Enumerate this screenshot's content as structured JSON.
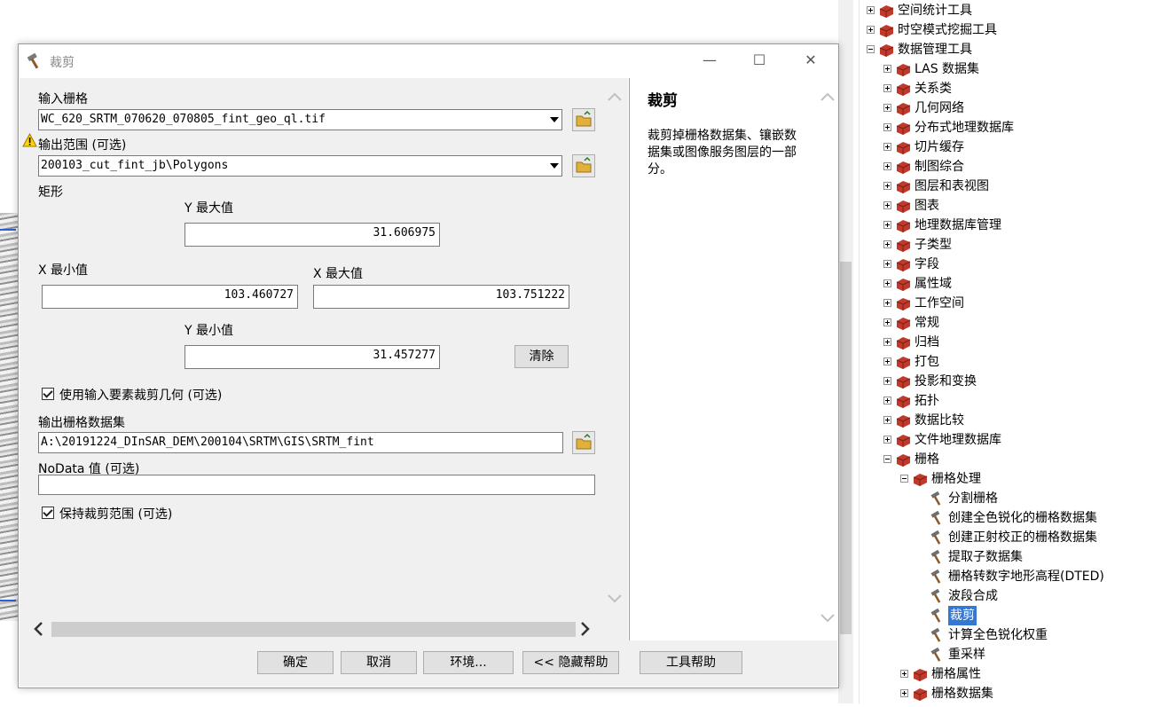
{
  "dialog": {
    "title": "裁剪",
    "input_raster_label": "输入栅格",
    "input_raster_value": "WC_620_SRTM_070620_070805_fint_geo_ql.tif",
    "output_extent_label": "输出范围 (可选)",
    "output_extent_value": "200103_cut_fint_jb\\Polygons",
    "rectangle_label": "矩形",
    "y_max_label": "Y 最大值",
    "y_max_value": "31.606975",
    "x_min_label": "X 最小值",
    "x_min_value": "103.460727",
    "x_max_label": "X 最大值",
    "x_max_value": "103.751222",
    "y_min_label": "Y 最小值",
    "y_min_value": "31.457277",
    "clear_button": "清除",
    "use_geometry_label": "使用输入要素裁剪几何 (可选)",
    "use_geometry_checked": true,
    "output_raster_label": "输出栅格数据集",
    "output_raster_value": "A:\\20191224_DInSAR_DEM\\200104\\SRTM\\GIS\\SRTM_fint",
    "nodata_label": "NoData 值 (可选)",
    "nodata_value": "",
    "maintain_extent_label": "保持裁剪范围 (可选)",
    "maintain_extent_checked": true,
    "help_title": "裁剪",
    "help_text": "裁剪掉栅格数据集、镶嵌数据集或图像服务图层的一部分。",
    "buttons": {
      "ok": "确定",
      "cancel": "取消",
      "env": "环境...",
      "hide_help": "<< 隐藏帮助",
      "tool_help": "工具帮助"
    }
  },
  "tree": {
    "top": [
      {
        "label": "空间统计工具",
        "state": "plus"
      },
      {
        "label": "时空模式挖掘工具",
        "state": "plus"
      },
      {
        "label": "数据管理工具",
        "state": "minus"
      }
    ],
    "data_mgmt_children": [
      "LAS 数据集",
      "关系类",
      "几何网络",
      "分布式地理数据库",
      "切片缓存",
      "制图综合",
      "图层和表视图",
      "图表",
      "地理数据库管理",
      "子类型",
      "字段",
      "属性域",
      "工作空间",
      "常规",
      "归档",
      "打包",
      "投影和变换",
      "拓扑",
      "数据比较",
      "文件地理数据库"
    ],
    "raster_label": "栅格",
    "raster_processing_label": "栅格处理",
    "raster_processing_tools": [
      "分割栅格",
      "创建全色锐化的栅格数据集",
      "创建正射校正的栅格数据集",
      "提取子数据集",
      "栅格转数字地形高程(DTED)",
      "波段合成",
      "裁剪",
      "计算全色锐化权重",
      "重采样"
    ],
    "selected_tool": "裁剪",
    "raster_siblings": [
      "栅格属性",
      "栅格数据集"
    ]
  }
}
